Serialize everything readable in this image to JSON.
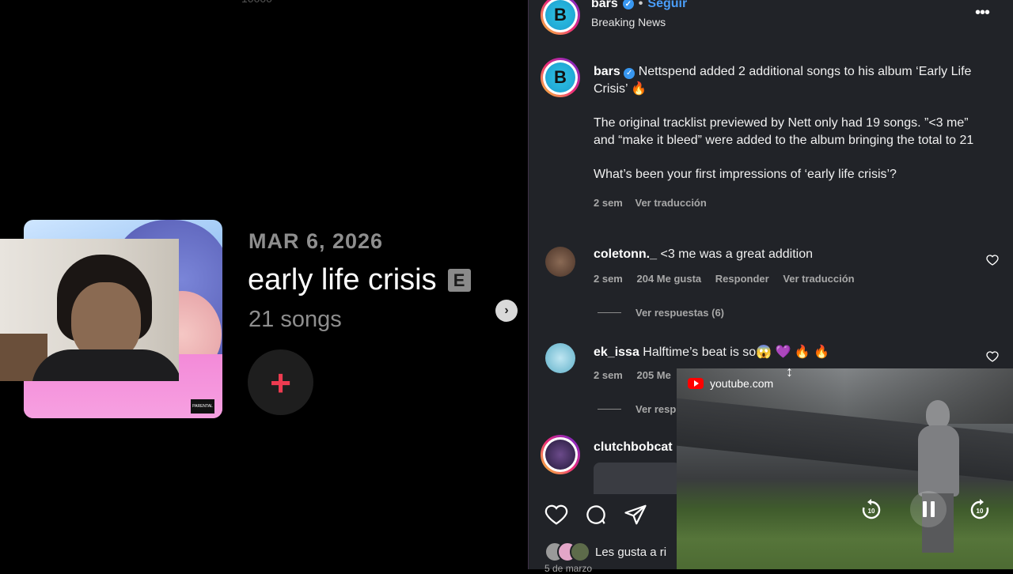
{
  "album_page": {
    "top_fragment": "10000",
    "release_date": "MAR 6, 2026",
    "album_title": "early life crisis",
    "explicit_badge": "E",
    "song_count": "21 songs",
    "add_icon": "plus-icon",
    "next_icon": "chevron-right-icon",
    "accent": "#ee3b50"
  },
  "post_header": {
    "account": "bars",
    "follow_label": "Seguir",
    "separator": "•",
    "subtitle": "Breaking News",
    "avatar_letter": "B"
  },
  "post": {
    "account": "bars",
    "line1": "Nettspend added 2 additional songs to his album ‘Early Life Crisis’ 🔥",
    "line2": "The original tracklist previewed by Nett only had 19 songs. ”<3 me” and “make it bleed” were added to the album bringing the total to 21",
    "line3": "What’s been your first impressions of ‘early life crisis’?",
    "time": "2 sem",
    "translate": "Ver traducción"
  },
  "comments": [
    {
      "user": "coletonn._",
      "text": "<3 me was a great addition",
      "time": "2 sem",
      "likes": "204 Me gusta",
      "reply": "Responder",
      "translate": "Ver traducción",
      "replies": "Ver respuestas (6)"
    },
    {
      "user": "ek_issa",
      "text": "Halftime’s beat is so😱 💜 🔥 🔥",
      "time": "2 sem",
      "likes": "205 Me",
      "replies": "Ver resp"
    },
    {
      "user": "clutchbobcat"
    }
  ],
  "footer": {
    "likes_text": "Les gusta a ri",
    "date_fragment": "5 de marzo"
  },
  "pip": {
    "source": "youtube.com",
    "rewind_label": "10",
    "forward_label": "10"
  }
}
